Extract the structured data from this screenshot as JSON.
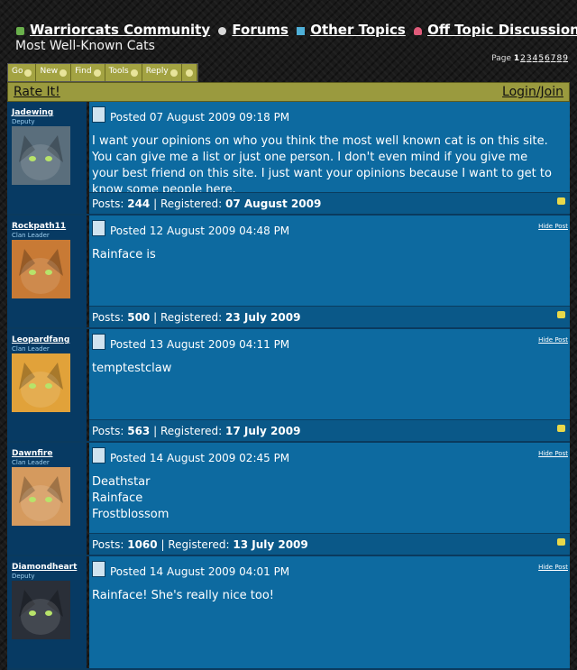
{
  "breadcrumbs": [
    "Warriorcats Community",
    "Forums",
    "Other Topics",
    "Off Topic Discussions"
  ],
  "thread_title": "Most Well-Known Cats",
  "pagination": {
    "label": "Page",
    "current": "1",
    "pages": [
      "2",
      "3",
      "4",
      "5",
      "6",
      "7",
      "8",
      "9"
    ]
  },
  "toolbar": [
    "Go",
    "New",
    "Find",
    "Tools",
    "Reply",
    ""
  ],
  "rate_label": "Rate It!",
  "login_label": "Login/Join",
  "stats_labels": {
    "posts": "Posts:",
    "registered": "Registered:",
    "sep": "|"
  },
  "hide_label": "Hide Post",
  "posts": [
    {
      "user": "Jadewing",
      "rank": "Deputy",
      "date": "Posted 07 August 2009 09:18 PM",
      "body": "I want your opinions on who you think the most well known cat is on this site. You can give me a list or just one person. I don't even mind if you give me your best friend on this site. I just want your opinions because I want to get to know some people here.",
      "posts": "244",
      "registered": "07 August 2009",
      "hide": false,
      "avatar": "#5a6e7c"
    },
    {
      "user": "Rockpath11",
      "rank": "Clan Leader",
      "date": "Posted 12 August 2009 04:48 PM",
      "body": "Rainface is",
      "posts": "500",
      "registered": "23 July 2009",
      "hide": true,
      "avatar": "#c87a35"
    },
    {
      "user": "Leopardfang",
      "rank": "Clan Leader",
      "date": "Posted 13 August 2009 04:11 PM",
      "body": "temptestclaw",
      "posts": "563",
      "registered": "17 July 2009",
      "hide": true,
      "avatar": "#e1a23a"
    },
    {
      "user": "Dawnfire",
      "rank": "Clan Leader",
      "date": "Posted 14 August 2009 02:45 PM",
      "body": "Deathstar\nRainface\nFrostblossom",
      "posts": "1060",
      "registered": "13 July 2009",
      "hide": true,
      "avatar": "#d59a5e"
    },
    {
      "user": "Diamondheart",
      "rank": "Deputy",
      "date": "Posted 14 August 2009 04:01 PM",
      "body": "Rainface! She's really nice too!",
      "posts": "",
      "registered": "",
      "hide": true,
      "avatar": "#2a2f38"
    }
  ]
}
